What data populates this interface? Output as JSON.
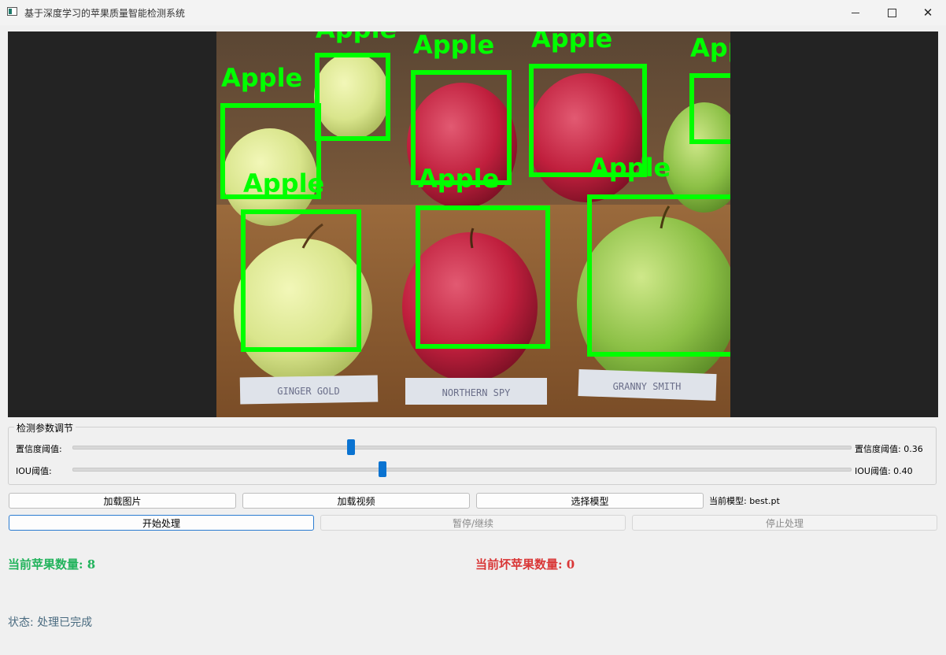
{
  "window": {
    "title": "基于深度学习的苹果质量智能检测系统"
  },
  "detection_view": {
    "boxes": [
      {
        "label": "Apple"
      },
      {
        "label": "Apple"
      },
      {
        "label": "Apple"
      },
      {
        "label": "Apple"
      },
      {
        "label": "Apple"
      },
      {
        "label": "Apple"
      },
      {
        "label": "Apple"
      },
      {
        "label": "Apple"
      }
    ],
    "name_tags": [
      "GINGER GOLD",
      "NORTHERN SPY",
      "GRANNY SMITH"
    ],
    "box_color": "#00ff00"
  },
  "params": {
    "group_title": "检测参数调节",
    "confidence": {
      "label": "置信度阈值:",
      "value_text": "置信度阈值: 0.36",
      "value": 0.36
    },
    "iou": {
      "label": "IOU阈值:",
      "value_text": "IOU阈值: 0.40",
      "value": 0.4
    }
  },
  "buttons": {
    "load_image": "加载图片",
    "load_video": "加载视频",
    "select_model": "选择模型",
    "start": "开始处理",
    "pause": "暂停/继续",
    "stop": "停止处理"
  },
  "model": {
    "label": "当前模型: best.pt"
  },
  "counts": {
    "good": "当前苹果数量: 8",
    "bad": "当前坏苹果数量: 0",
    "good_color": "#22b35c",
    "bad_color": "#d93636"
  },
  "status": {
    "text": "状态: 处理已完成"
  }
}
